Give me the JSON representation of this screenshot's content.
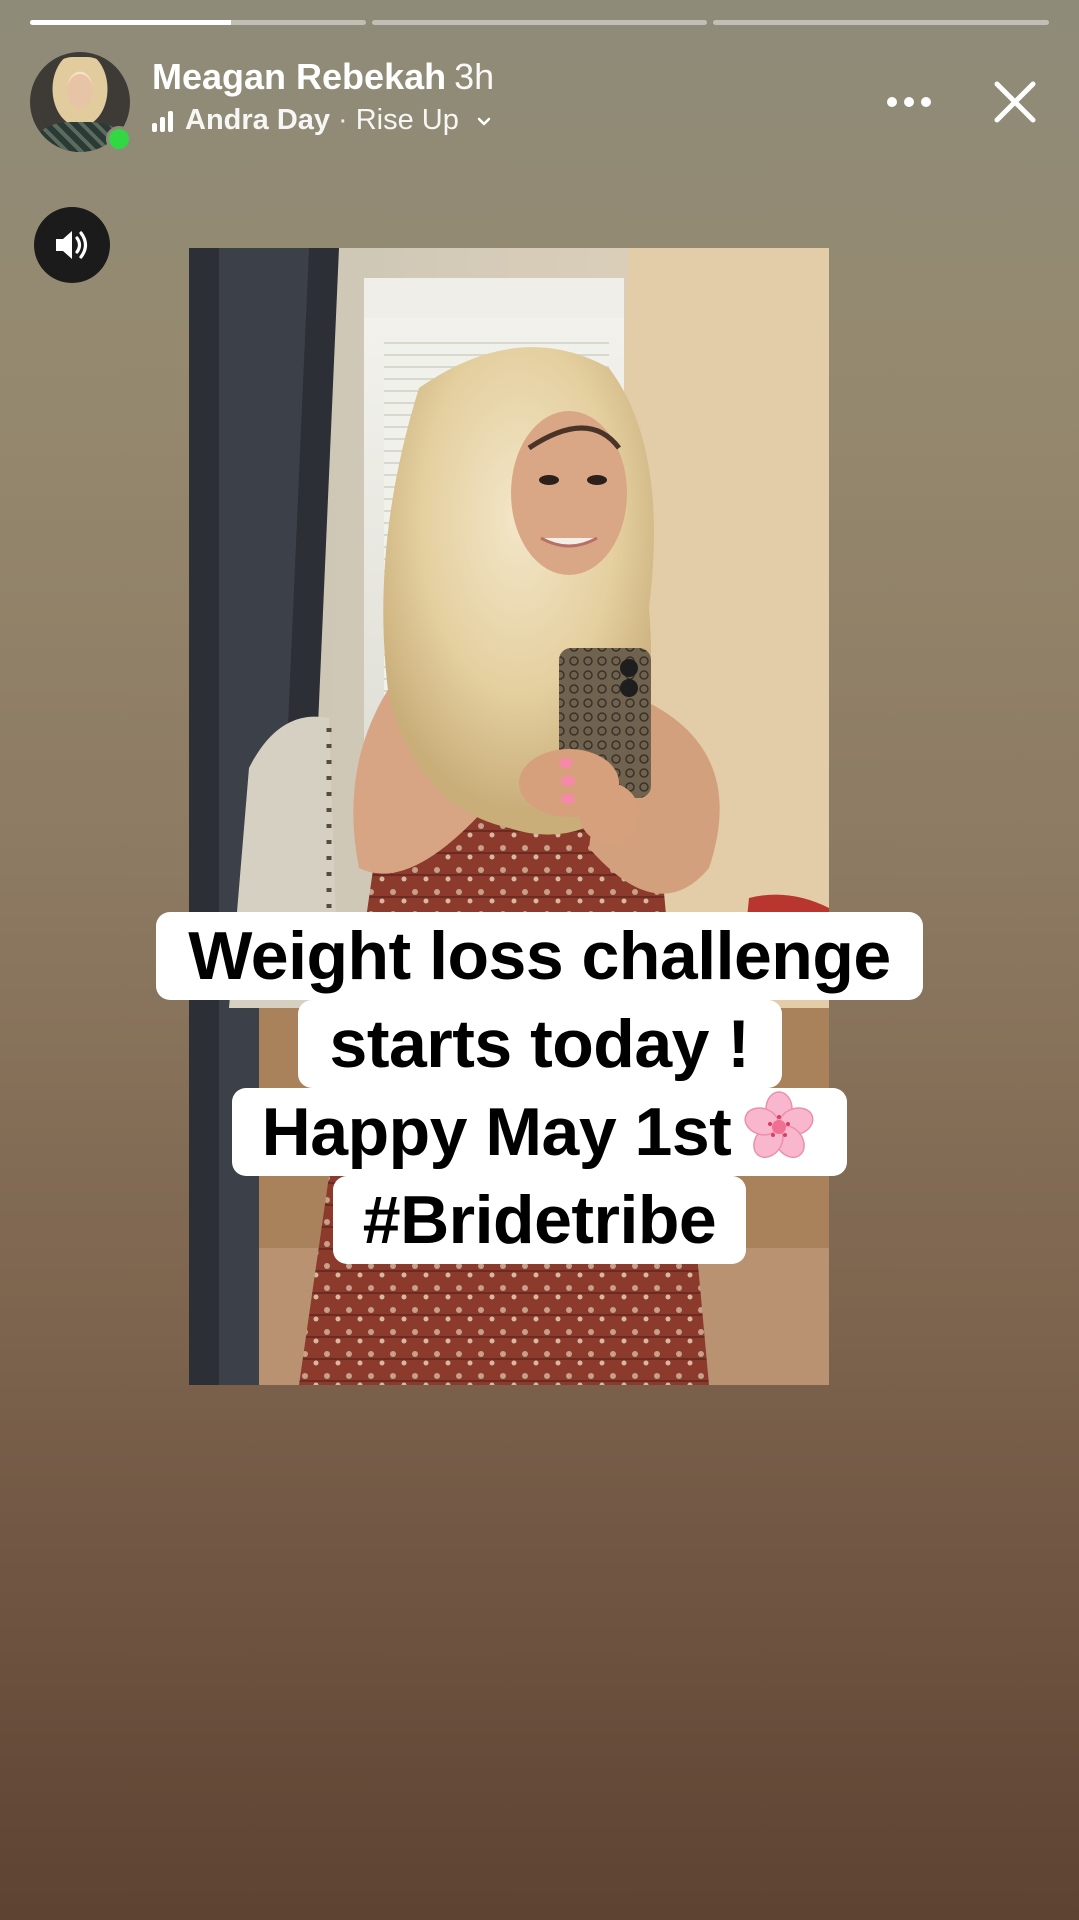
{
  "progress": {
    "segments": [
      {
        "fill": 0.6
      },
      {
        "fill": 0
      },
      {
        "fill": 0
      }
    ]
  },
  "header": {
    "username": "Meagan Rebekah",
    "time_ago": "3h",
    "music_artist": "Andra Day",
    "music_separator": "·",
    "music_song": "Rise Up"
  },
  "icons": {
    "more": "more-options-icon",
    "close": "close-icon",
    "sound": "speaker-on-icon",
    "music": "music-bars-icon",
    "chevron": "chevron-down-icon"
  },
  "caption": {
    "line1": "Weight loss challenge",
    "line2": "starts today !",
    "line3": "Happy May 1st",
    "line4": "#Bridetribe"
  },
  "colors": {
    "online": "#31d843",
    "caption_bg": "#ffffff",
    "caption_text": "#000000"
  }
}
